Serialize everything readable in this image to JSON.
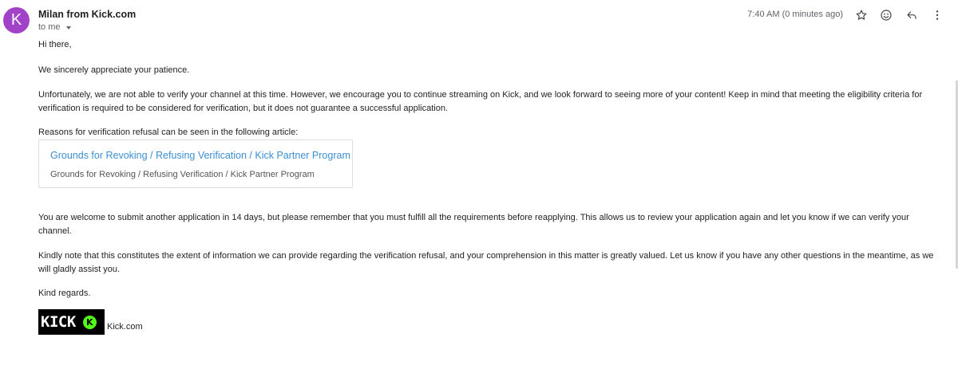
{
  "sender": {
    "avatar_letter": "K",
    "avatar_color": "#a142c9",
    "name": "Milan from Kick.com",
    "recipient": "to me"
  },
  "timestamp": "7:40 AM (0 minutes ago)",
  "actions": [
    {
      "name": "star-icon"
    },
    {
      "name": "emoji-icon"
    },
    {
      "name": "reply-icon"
    },
    {
      "name": "more-options-icon"
    }
  ],
  "message": {
    "greeting": "Hi there,",
    "p1": "We sincerely appreciate your patience.",
    "p2": "Unfortunately, we are not able to verify your channel at this time. However, we encourage you to continue streaming on Kick, and we look forward to seeing more of your content! Keep in mind that meeting the eligibility criteria for verification is required to be considered for verification, but it does not guarantee a successful application.",
    "p3": "Reasons for verification refusal can be seen in the following article:",
    "link_card": {
      "title": "Grounds for Revoking / Refusing Verification / Kick Partner Program",
      "subtitle": "Grounds for Revoking / Refusing Verification / Kick Partner Program",
      "title_color": "#3c8fd1"
    },
    "p4": "You are welcome to submit another application in 14 days, but please remember that you must fulfill all the requirements before reapplying. This allows us to review your application again and let you know if we can verify your channel.",
    "p5": "Kindly note that this constitutes the extent of information we can provide regarding the verification refusal, and your comprehension in this matter is greatly valued. Let us know if you have any other questions in the meantime, as we will gladly assist you.",
    "signoff": "Kind regards.",
    "logo": {
      "word": "KICK",
      "mark": "K",
      "accent_color": "#53fc18"
    },
    "brand_link": "Kick.com"
  }
}
